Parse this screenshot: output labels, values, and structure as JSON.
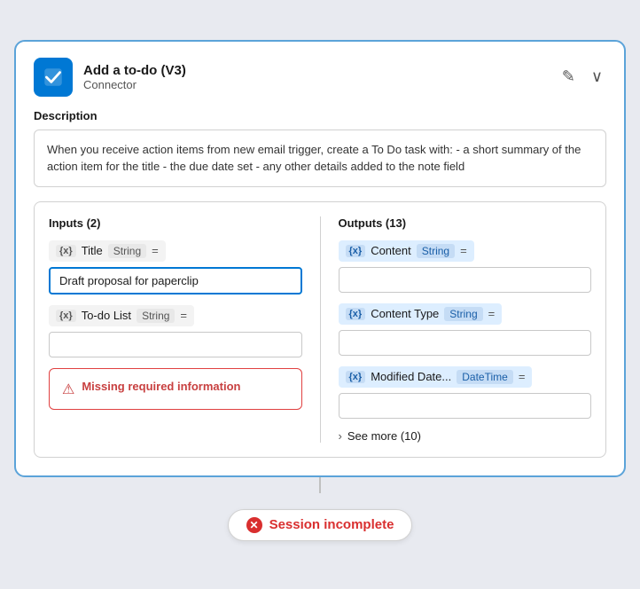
{
  "header": {
    "title": "Add a to-do (V3)",
    "subtitle": "Connector",
    "edit_icon": "✎",
    "collapse_icon": "∨"
  },
  "description": {
    "label": "Description",
    "text": "When you receive action items from new email trigger, create a To Do task with: - a short summary of the action item for the title - the due date set - any other details added to the note field"
  },
  "inputs": {
    "title": "Inputs (2)",
    "fields": [
      {
        "badge": "{x}",
        "name": "Title",
        "type": "String",
        "eq": "=",
        "value": "Draft proposal for paperclip",
        "placeholder": ""
      },
      {
        "badge": "{x}",
        "name": "To-do List",
        "type": "String",
        "eq": "=",
        "value": "",
        "placeholder": ""
      }
    ],
    "error": {
      "message": "Missing required information"
    }
  },
  "outputs": {
    "title": "Outputs (13)",
    "fields": [
      {
        "badge": "{x}",
        "name": "Content",
        "type": "String",
        "eq": "=",
        "value": "",
        "placeholder": ""
      },
      {
        "badge": "{x}",
        "name": "Content Type",
        "type": "String",
        "eq": "=",
        "value": "",
        "placeholder": ""
      },
      {
        "badge": "{x}",
        "name": "Modified Date...",
        "type": "DateTime",
        "eq": "=",
        "value": "",
        "placeholder": ""
      }
    ],
    "see_more": {
      "label": "See more (10)"
    }
  },
  "session_badge": {
    "icon": "✕",
    "text": "Session incomplete"
  }
}
